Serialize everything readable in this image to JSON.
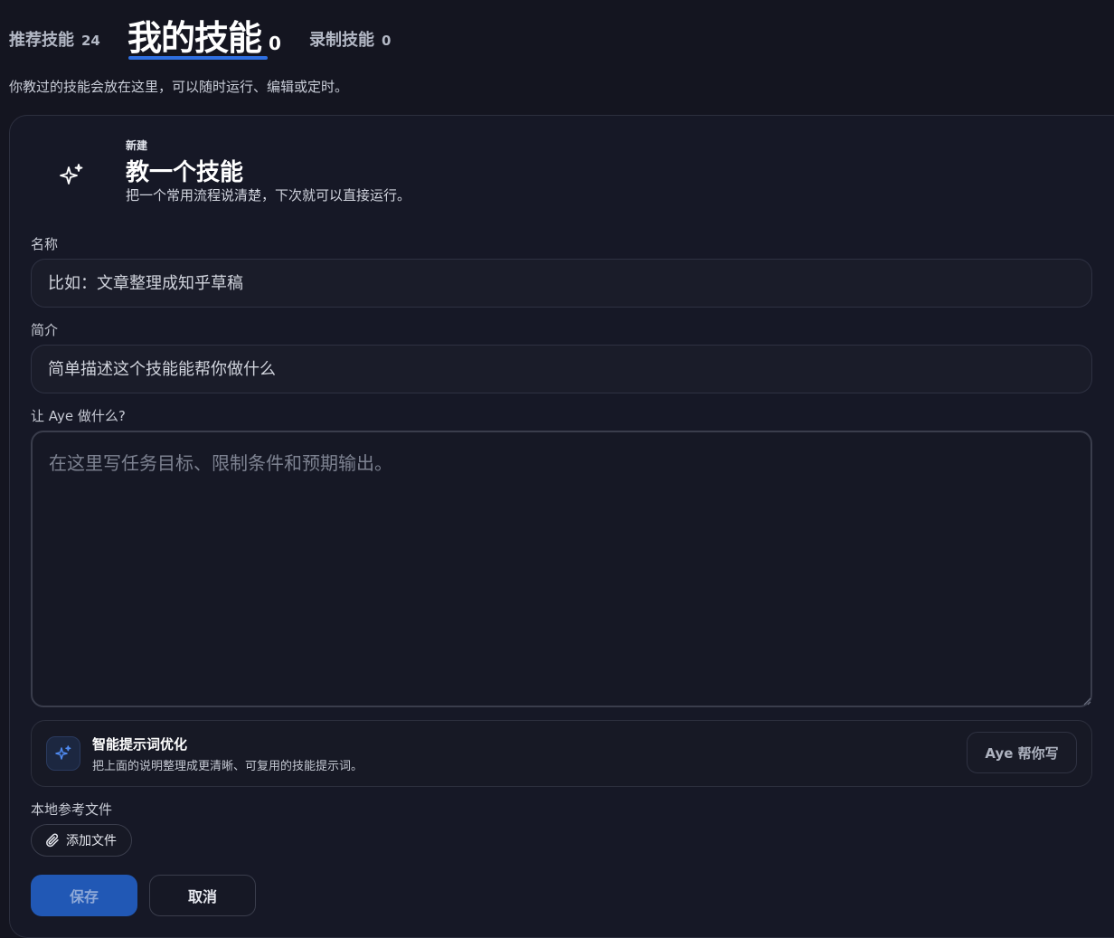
{
  "tabs": [
    {
      "label": "推荐技能",
      "count": "24"
    },
    {
      "label": "我的技能",
      "count": "0"
    },
    {
      "label": "录制技能",
      "count": "0"
    }
  ],
  "subtitle": "你教过的技能会放在这里，可以随时运行、编辑或定时。",
  "new_skill": {
    "eyebrow": "新建",
    "title": "教一个技能",
    "description": "把一个常用流程说清楚，下次就可以直接运行。",
    "icon": "sparkle-icon"
  },
  "form": {
    "name_label": "名称",
    "name_placeholder": "比如：文章整理成知乎草稿",
    "intro_label": "简介",
    "intro_placeholder": "简单描述这个技能能帮你做什么",
    "task_label": "让 Aye 做什么?",
    "task_placeholder": "在这里写任务目标、限制条件和预期输出。"
  },
  "optimize": {
    "title": "智能提示词优化",
    "description": "把上面的说明整理成更清晰、可复用的技能提示词。",
    "button_label": "Aye 帮你写",
    "icon": "sparkle-icon"
  },
  "attachments": {
    "label": "本地参考文件",
    "button_label": "添加文件",
    "icon": "paperclip-icon"
  },
  "actions": {
    "save_label": "保存",
    "cancel_label": "取消"
  },
  "colors": {
    "background": "#141520",
    "accent": "#2f6fe0",
    "primary_button": "#2158b5"
  }
}
